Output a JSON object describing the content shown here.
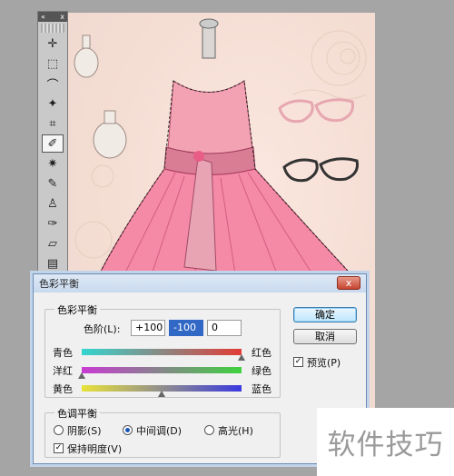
{
  "tools_panel": {
    "collapse_label": "«",
    "close_label": "x",
    "tools": [
      {
        "name": "move-tool-icon",
        "glyph": "✛"
      },
      {
        "name": "marquee-tool-icon",
        "glyph": "⬚"
      },
      {
        "name": "lasso-tool-icon",
        "glyph": "⌒"
      },
      {
        "name": "magic-wand-tool-icon",
        "glyph": "✦"
      },
      {
        "name": "crop-tool-icon",
        "glyph": "⌗"
      },
      {
        "name": "eyedropper-tool-icon",
        "glyph": "✐",
        "active": true
      },
      {
        "name": "healing-brush-tool-icon",
        "glyph": "✷"
      },
      {
        "name": "brush-tool-icon",
        "glyph": "✎"
      },
      {
        "name": "stamp-tool-icon",
        "glyph": "♙"
      },
      {
        "name": "history-brush-tool-icon",
        "glyph": "✑"
      },
      {
        "name": "eraser-tool-icon",
        "glyph": "▱"
      },
      {
        "name": "gradient-tool-icon",
        "glyph": "▤"
      },
      {
        "name": "blur-tool-icon",
        "glyph": "◒"
      }
    ]
  },
  "dialog": {
    "title": "色彩平衡",
    "close_label": "x",
    "color_balance": {
      "legend": "色彩平衡",
      "levels_label": "色阶(L):",
      "levels": [
        "+100",
        "-100",
        "0"
      ],
      "sliders": [
        {
          "left": "青色",
          "right": "红色",
          "value": 100,
          "colors": [
            "#33d6cf",
            "#e23b36"
          ]
        },
        {
          "left": "洋红",
          "right": "绿色",
          "value": -100,
          "colors": [
            "#c93bd3",
            "#3fd23f"
          ]
        },
        {
          "left": "黄色",
          "right": "蓝色",
          "value": 0,
          "colors": [
            "#e8e23a",
            "#3a3ae0"
          ]
        }
      ]
    },
    "tone_balance": {
      "legend": "色调平衡",
      "options": [
        "阴影(S)",
        "中间调(D)",
        "高光(H)"
      ],
      "selected_index": 1,
      "preserve_luminosity_label": "保持明度(V)",
      "preserve_luminosity_checked": true
    },
    "ok_label": "确定",
    "cancel_label": "取消",
    "preview_label": "预览(P)",
    "preview_checked": true
  },
  "watermark": "软件技巧"
}
